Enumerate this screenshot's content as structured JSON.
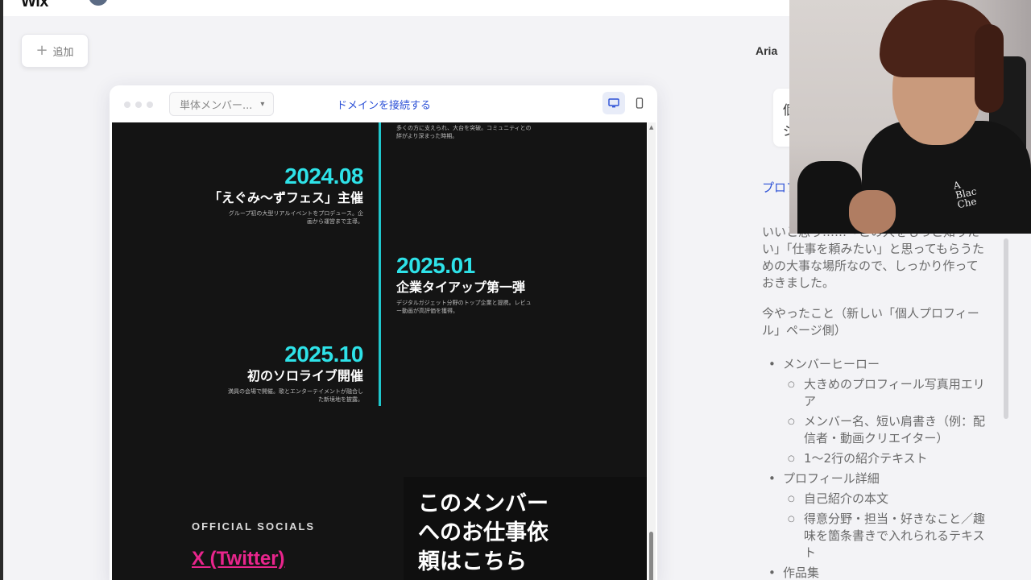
{
  "editor": {
    "brand": "Wix",
    "add_button": "追加",
    "user_name": "Aria",
    "page_selector": "単体メンバー...",
    "connect_domain": "ドメインを接続する",
    "devices": [
      "desktop-icon",
      "mobile-icon"
    ]
  },
  "site": {
    "top_description": "多くの方に支えられ、大台を突破。コミュニティとの絆がより深まった時期。",
    "timeline": [
      {
        "date": "2024.08",
        "title": "「えぐみ〜ずフェス」主催",
        "description": "グループ初の大型リアルイベントをプロデュース。企画から運営まで主導。"
      },
      {
        "date": "2025.01",
        "title": "企業タイアップ第一弾",
        "description": "デジタルガジェット分野のトップ企業と提携。レビュー動画が高評価を獲得。"
      },
      {
        "date": "2025.10",
        "title": "初のソロライブ開催",
        "description": "満員の会場で開催。歌とエンターテイメントが融合した新境地を披露。"
      }
    ],
    "socials_label": "OFFICIAL SOCIALS",
    "social_link": "X (Twitter)",
    "contact_heading": "このメンバーへのお仕事依頼はこちら"
  },
  "chat": {
    "bubble_text": "個ジ",
    "link_text": "プロフィールにいます",
    "paragraph1": "いいと思う……「この人をもっと知りたい」「仕事を頼みたい」と思ってもらうための大事な場所なので、しっかり作っておきました。",
    "paragraph2": "今やったこと（新しい「個人プロフィール」ページ側）",
    "items": [
      {
        "label": "メンバーヒーロー",
        "sub": [
          "大きめのプロフィール写真用エリア",
          "メンバー名、短い肩書き（例：配信者・動画クリエイター）",
          "1〜2行の紹介テキスト"
        ]
      },
      {
        "label": "プロフィール詳細",
        "sub": [
          "自己紹介の本文",
          "得意分野・担当・好きなこと／趣味を箇条書きで入れられるテキスト"
        ]
      },
      {
        "label": "作品集",
        "sub": []
      }
    ]
  },
  "colors": {
    "accent_cyan": "#2ee2e8",
    "timeline_line": "#1fc7cc",
    "social_pink": "#e8258c",
    "link_blue": "#2a4fd6",
    "site_bg": "#141414"
  }
}
